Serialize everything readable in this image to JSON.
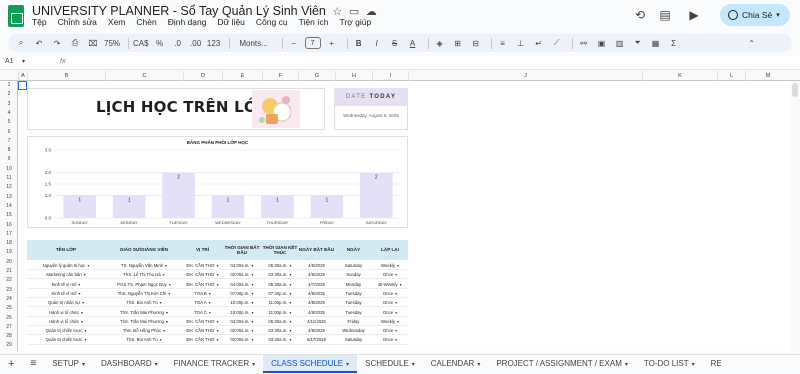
{
  "app": {
    "title": "UNIVERSITY PLANNER - Sổ Tay Quản Lý Sinh Viên",
    "menus": [
      "Tệp",
      "Chỉnh sửa",
      "Xem",
      "Chèn",
      "Định dạng",
      "Dữ liệu",
      "Công cụ",
      "Tiện ích",
      "Trợ giúp"
    ],
    "share_label": "Chia Sẻ"
  },
  "toolbar": {
    "zoom": "75%",
    "currency": "CA$",
    "percent": "%",
    "dec_less": ".0",
    "dec_more": ".00",
    "number_format": "123",
    "font": "Monts...",
    "font_size": "7",
    "bold": "B",
    "italic": "I",
    "strike": "S",
    "text_color": "A"
  },
  "formula_bar": {
    "cell_ref": "A1",
    "fx": "fx"
  },
  "columns": [
    "A",
    "B",
    "C",
    "D",
    "E",
    "F",
    "G",
    "H",
    "I",
    "J",
    "K",
    "L",
    "M"
  ],
  "rows": [
    "1",
    "2",
    "3",
    "4",
    "5",
    "6",
    "7",
    "8",
    "9",
    "10",
    "11",
    "12",
    "13",
    "14",
    "15",
    "16",
    "17",
    "18",
    "19",
    "20",
    "21",
    "22",
    "23",
    "24",
    "25",
    "26",
    "27",
    "28",
    "29"
  ],
  "header_card": {
    "title": "LỊCH HỌC TRÊN LỚP"
  },
  "date_card": {
    "label_a": "DATE",
    "label_b": "TODAY",
    "value": "Wednesday, August 6, 2025"
  },
  "chart_data": {
    "type": "bar",
    "title": "BẢNG PHÂN PHỐI LỚP HỌC",
    "categories": [
      "SUNDAY",
      "MONDAY",
      "TUESDAY",
      "WEDNESDAY",
      "THURSDAY",
      "FRIDAY",
      "SATURDAY"
    ],
    "values": [
      1,
      1,
      2,
      1,
      1,
      1,
      2
    ],
    "ylim": [
      0,
      3
    ],
    "yticks": [
      "0.0",
      "1.0",
      "1.5",
      "2.0",
      "3.0"
    ],
    "bar_color": "#e4e0f7",
    "grid": true
  },
  "table": {
    "headers": [
      "TÊN LỚP",
      "GIÁO SƯ/GIẢNG VIÊN",
      "VỊ TRÍ",
      "THỜI GIAN BẮT ĐẦU",
      "THỜI GIAN KẾT THÚC",
      "NGÀY BẮT ĐẦU",
      "NGÀY",
      "LẶP LẠI"
    ],
    "rows": [
      [
        "Nguyên lý quản trị học",
        "TS. Nguyễn Văn Minh",
        "ĐH. CẦN THƠ",
        "04:00a.m.",
        "05:30a.m.",
        "4/5/2025",
        "Saturday",
        "Weekly"
      ],
      [
        "Marketing căn bản",
        "ThS. Lê Thị Thu Hà",
        "ĐH. CẦN THƠ",
        "02:00a.m.",
        "03:30a.m.",
        "4/6/2025",
        "Sunday",
        "Once"
      ],
      [
        "Kinh tế vi mô",
        "PGS.TS. Phạm Ngọc Duy",
        "ĐH. CẦN THƠ",
        "04:00a.m.",
        "05:30a.m.",
        "4/7/2025",
        "Monday",
        "Bi-Weekly"
      ],
      [
        "Kinh tế vĩ mô",
        "ThS. Nguyễn Thị Kim Chi",
        "TOA B",
        "07:00p.m.",
        "07:30p.m.",
        "4/8/2025",
        "Tuesday",
        "Once"
      ],
      [
        "Quản trị nhân sự",
        "ThS. Bùi Anh Tú",
        "TOA A",
        "10:00p.m.",
        "11:00p.m.",
        "4/8/2025",
        "Tuesday",
        "Once"
      ],
      [
        "Hành vi tổ chức",
        "ThS. Trần Mai Phương",
        "TOA C",
        "10:00p.m.",
        "11:00p.m.",
        "4/9/2025",
        "Tuesday",
        "Once"
      ],
      [
        "Hành vi tổ chức",
        "ThS. Trần Mai Phương",
        "ĐH. CẦN THƠ",
        "04:00a.m.",
        "05:30a.m.",
        "4/11/2025",
        "Friday",
        "Weekly"
      ],
      [
        "Quản trị chiến lược",
        "ThS. Đỗ Hồng Phúc",
        "ĐH. CẦN THƠ",
        "02:00a.m.",
        "03:30a.m.",
        "4/9/2025",
        "Wednesday",
        "Once"
      ],
      [
        "Quản trị chiến lược",
        "ThS. Bùi Anh Tú",
        "ĐH. CẦN THƠ",
        "02:00a.m.",
        "03:30a.m.",
        "5/17/2025",
        "Saturday",
        "Once"
      ]
    ]
  },
  "sheet_tabs": [
    "SETUP",
    "DASHBOARD",
    "FINANCE TRACKER",
    "CLASS SCHEDULE",
    "SCHEDULE",
    "CALENDAR",
    "PROJECT / ASSIGNMENT / EXAM",
    "TO-DO LIST",
    "RE"
  ],
  "active_tab": "CLASS SCHEDULE",
  "colors": {
    "accent": "#0b57d0",
    "share_bg": "#c2e7ff",
    "header_fill": "#d4eaf3",
    "sheets_green": "#0f9d58"
  }
}
